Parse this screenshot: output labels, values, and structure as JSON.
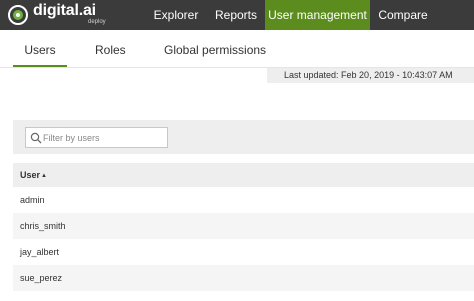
{
  "header": {
    "logo_text": "digital.ai",
    "logo_sub": "deploy",
    "nav": [
      "Explorer",
      "Reports",
      "User management",
      "Compare"
    ],
    "active_nav": "User management",
    "accent_color": "#5b8c1d"
  },
  "tabs": {
    "items": [
      "Users",
      "Roles",
      "Global permissions"
    ],
    "active": "Users"
  },
  "last_updated": "Last updated: Feb 20, 2019 - 10:43:07 AM",
  "filter": {
    "placeholder": "Filter by users",
    "value": ""
  },
  "table": {
    "columns": [
      "User"
    ],
    "sort": "ascending",
    "rows": [
      "admin",
      "chris_smith",
      "jay_albert",
      "sue_perez"
    ]
  }
}
